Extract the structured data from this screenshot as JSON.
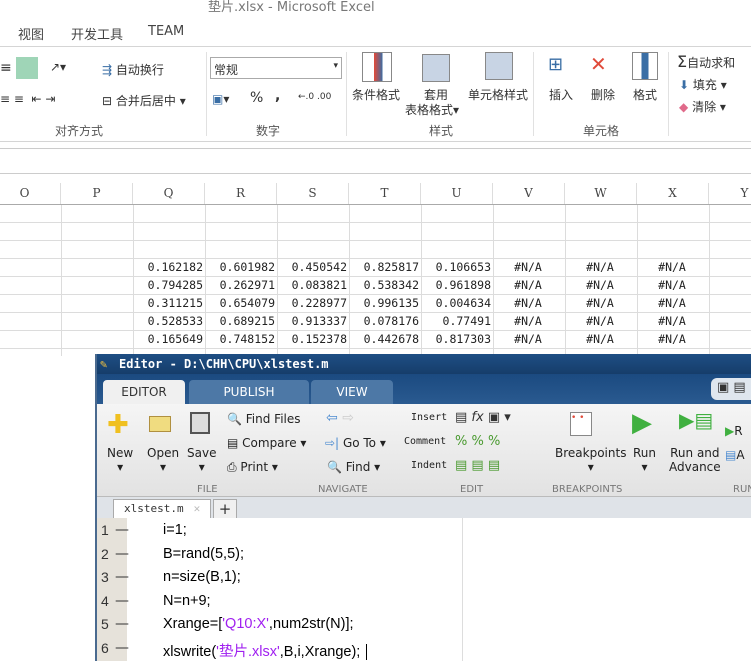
{
  "excel": {
    "title": "垫片.xlsx - Microsoft Excel",
    "tabs": [
      "视图",
      "开发工具",
      "TEAM"
    ],
    "ribbon": {
      "wrap_text": "自动换行",
      "merge_center": "合并后居中",
      "number_format": "常规",
      "percent": "%",
      "comma": ",",
      "cond_format": "条件格式",
      "table_format_1": "套用",
      "table_format_2": "表格格式",
      "cell_style": "单元格样式",
      "insert": "插入",
      "delete": "删除",
      "format": "格式",
      "autosum": "自动求和",
      "fill": "填充",
      "clear": "清除",
      "groups": {
        "alignment": "对齐方式",
        "number": "数字",
        "styles": "样式",
        "cells": "单元格"
      }
    },
    "columns": [
      "O",
      "P",
      "Q",
      "R",
      "S",
      "T",
      "U",
      "V",
      "W",
      "X",
      "Y"
    ],
    "rows": [
      [
        "0.162182",
        "0.601982",
        "0.450542",
        "0.825817",
        "0.106653",
        "#N/A",
        "#N/A",
        "#N/A"
      ],
      [
        "0.794285",
        "0.262971",
        "0.083821",
        "0.538342",
        "0.961898",
        "#N/A",
        "#N/A",
        "#N/A"
      ],
      [
        "0.311215",
        "0.654079",
        "0.228977",
        "0.996135",
        "0.004634",
        "#N/A",
        "#N/A",
        "#N/A"
      ],
      [
        "0.528533",
        "0.689215",
        "0.913337",
        "0.078176",
        "0.77491",
        "#N/A",
        "#N/A",
        "#N/A"
      ],
      [
        "0.165649",
        "0.748152",
        "0.152378",
        "0.442678",
        "0.817303",
        "#N/A",
        "#N/A",
        "#N/A"
      ]
    ]
  },
  "editor": {
    "title": "Editor - D:\\CHH\\CPU\\xlstest.m",
    "tabs": [
      "EDITOR",
      "PUBLISH",
      "VIEW"
    ],
    "toolbar": {
      "new": "New",
      "open": "Open",
      "save": "Save",
      "find_files": "Find Files",
      "compare": "Compare",
      "print": "Print",
      "go_to": "Go To",
      "find": "Find",
      "insert": "Insert",
      "comment": "Comment",
      "indent": "Indent",
      "fx": "fx",
      "breakpoints": "Breakpoints",
      "run": "Run",
      "run_advance_1": "Run and",
      "run_advance_2": "Advance",
      "r": "R",
      "a": "A",
      "groups": {
        "file": "FILE",
        "navigate": "NAVIGATE",
        "edit": "EDIT",
        "breakpoints": "BREAKPOINTS",
        "run": "RUN"
      }
    },
    "file_tab": "xlstest.m",
    "add_tab": "+",
    "lines": [
      {
        "n": "1",
        "code": "i=1;"
      },
      {
        "n": "2",
        "code": "B=rand(5,5);"
      },
      {
        "n": "3",
        "code": "n=size(B,1);"
      },
      {
        "n": "4",
        "code": "N=n+9;"
      },
      {
        "n": "5",
        "pre": "Xrange=[",
        "str": "'Q10:X'",
        "post": ",num2str(N)];"
      },
      {
        "n": "6",
        "pre": "xlswrite(",
        "str": "'垫片.xlsx'",
        "post": ",B,i,Xrange);"
      }
    ]
  }
}
